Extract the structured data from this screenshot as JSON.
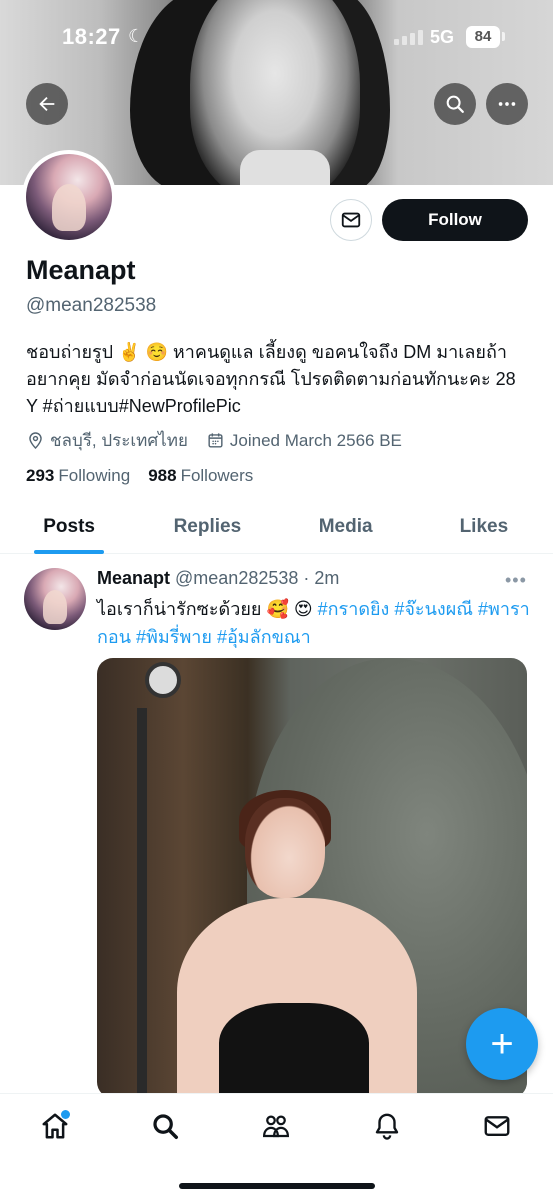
{
  "status_bar": {
    "time": "18:27",
    "network": "5G",
    "battery": "84"
  },
  "profile": {
    "name": "Meanapt",
    "handle": "@mean282538",
    "bio": "ชอบถ่ายรูป ✌️ ☺️ หาคนดูแล เลี้ยงดู ขอคนใจถึง DM มาเลยถ้าอยากคุย มัดจำก่อนนัดเจอทุกกรณี โปรดติดตามก่อนทักนะคะ 28 Y #ถ่ายแบบ#NewProfilePic",
    "location": "ชลบุรี, ประเทศไทย",
    "joined": "Joined March 2566 BE",
    "following_count": "293",
    "following_label": "Following",
    "followers_count": "988",
    "followers_label": "Followers",
    "follow_button": "Follow"
  },
  "tabs": [
    {
      "label": "Posts",
      "active": true
    },
    {
      "label": "Replies",
      "active": false
    },
    {
      "label": "Media",
      "active": false
    },
    {
      "label": "Likes",
      "active": false
    }
  ],
  "post": {
    "name": "Meanapt",
    "handle": "@mean282538",
    "sep": "·",
    "time": "2m",
    "text": "ไอเราก็น่ารักซะด้วยย 🥰 😍",
    "hashtags": [
      "#กราดยิง",
      "#จ๊ะนงผณี",
      "#พารากอน",
      "#พิมรี่พาย",
      "#อุ้มลักขณา"
    ],
    "more": "•••"
  },
  "fab_label": "+",
  "icons": {
    "back": "back-arrow-icon",
    "search": "search-icon",
    "more": "more-horizontal-icon",
    "message": "envelope-icon",
    "location": "location-pin-icon",
    "calendar": "calendar-icon"
  },
  "colors": {
    "accent": "#1d9bf0",
    "text": "#0f1419",
    "secondary": "#536471"
  }
}
